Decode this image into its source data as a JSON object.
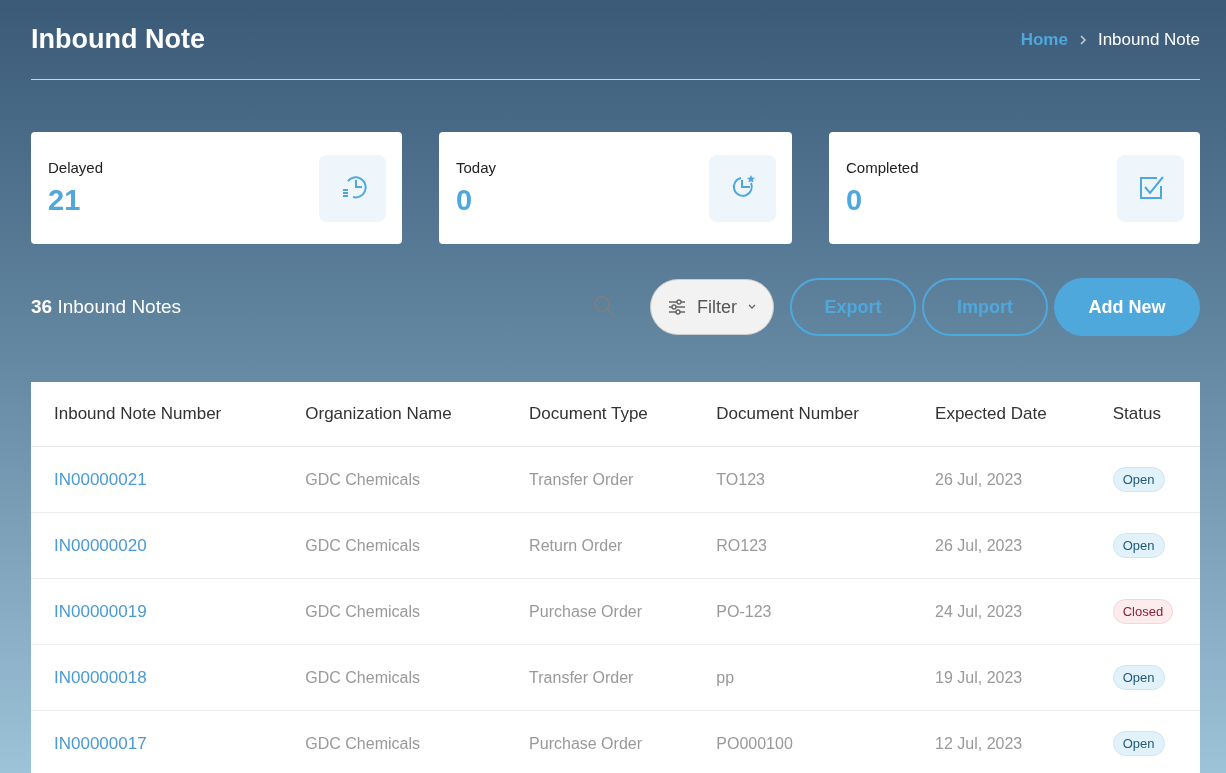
{
  "page": {
    "title": "Inbound Note"
  },
  "breadcrumb": [
    {
      "label": "Home",
      "kind": "link"
    },
    {
      "label": "Inbound Note",
      "kind": "current"
    }
  ],
  "cards": [
    {
      "label": "Delayed",
      "value": "21",
      "kind": "delayed"
    },
    {
      "label": "Today",
      "value": "0",
      "kind": "today"
    },
    {
      "label": "Completed",
      "value": "0",
      "kind": "completed"
    }
  ],
  "toolbar": {
    "count": "**36** Inbound Notes",
    "filter": "Filter",
    "buttons": [
      {
        "label": "Export",
        "kind": "outline"
      },
      {
        "label": "Import",
        "kind": "outline"
      },
      {
        "label": "Add New",
        "kind": "primary"
      }
    ]
  },
  "table": {
    "columns": [
      "Inbound Note Number",
      "Organization Name",
      "Document Type",
      "Document Number",
      "Expected Date",
      "Status"
    ],
    "rows": [
      {
        "number": "IN00000021",
        "organization": "GDC Chemicals",
        "doc_type": "Transfer Order",
        "doc_number": "TO123",
        "date": "26 Jul, 2023",
        "status": "Open",
        "kind": "open"
      },
      {
        "number": "IN00000020",
        "organization": "GDC Chemicals",
        "doc_type": "Return Order",
        "doc_number": "RO123",
        "date": "26 Jul, 2023",
        "status": "Open",
        "kind": "open"
      },
      {
        "number": "IN00000019",
        "organization": "GDC Chemicals",
        "doc_type": "Purchase Order",
        "doc_number": "PO-123",
        "date": "24 Jul, 2023",
        "status": "Closed",
        "kind": "closed"
      },
      {
        "number": "IN00000018",
        "organization": "GDC Chemicals",
        "doc_type": "Transfer Order",
        "doc_number": "pp",
        "date": "19 Jul, 2023",
        "status": "Open",
        "kind": "open"
      },
      {
        "number": "IN00000017",
        "organization": "GDC Chemicals",
        "doc_type": "Purchase Order",
        "doc_number": "PO000100",
        "date": "12 Jul, 2023",
        "status": "Open",
        "kind": "open"
      }
    ]
  }
}
